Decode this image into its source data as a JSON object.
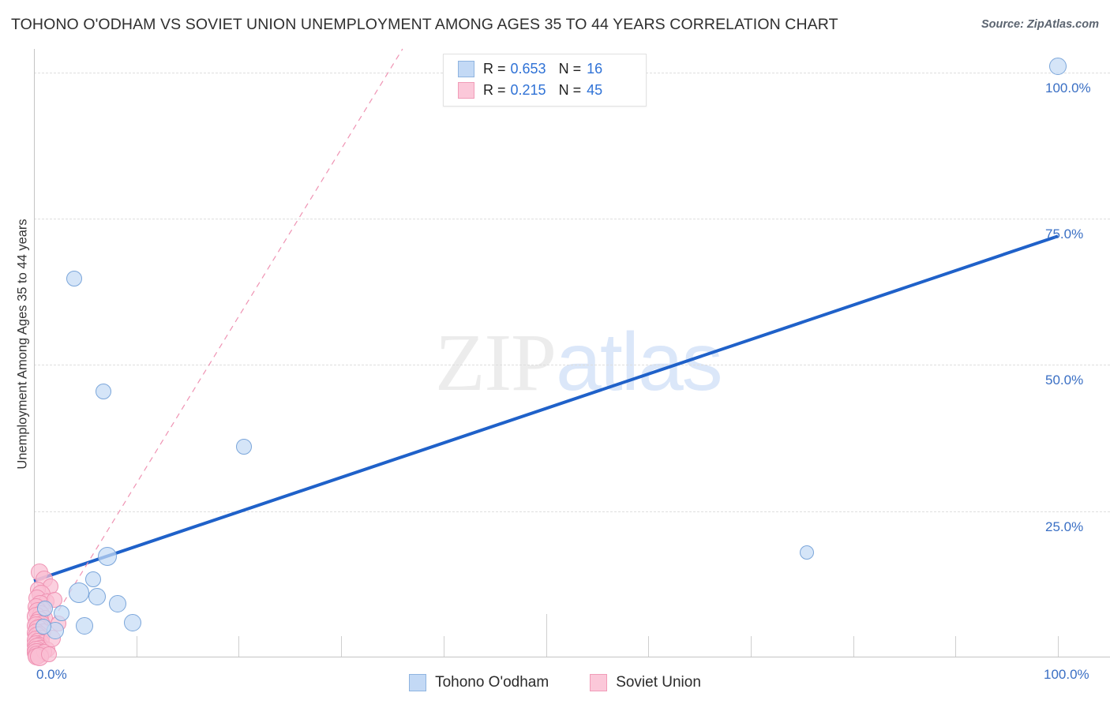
{
  "header": {
    "title": "TOHONO O'ODHAM VS SOVIET UNION UNEMPLOYMENT AMONG AGES 35 TO 44 YEARS CORRELATION CHART",
    "source": "Source: ZipAtlas.com"
  },
  "watermark": {
    "part1": "ZIP",
    "part2": "atlas"
  },
  "stats": {
    "rows": [
      {
        "series": "Tohono O'odham",
        "r_label": "R =",
        "r_value": "0.653",
        "n_label": "N =",
        "n_value": "16",
        "color": "#c3d9f5"
      },
      {
        "series": "Soviet Union",
        "r_label": "R =",
        "r_value": "0.215",
        "n_label": "N =",
        "n_value": "45",
        "color": "#fbc8d9"
      }
    ]
  },
  "legend": {
    "items": [
      {
        "label": "Tohono O'odham",
        "color": "#c3d9f5"
      },
      {
        "label": "Soviet Union",
        "color": "#fbc8d9"
      }
    ]
  },
  "axes": {
    "y_title": "Unemployment Among Ages 35 to 44 years",
    "y_ticks": [
      "100.0%",
      "75.0%",
      "50.0%",
      "25.0%"
    ],
    "x_ticks": [
      "0.0%",
      "100.0%"
    ],
    "tick_color": "#3a6fc4"
  },
  "chart_data": {
    "type": "scatter",
    "title": "Tohono O'odham vs Soviet Union Unemployment Among Ages 35 to 44 Years Correlation Chart",
    "xlabel": "",
    "ylabel": "Unemployment Among Ages 35 to 44 years",
    "xlim": [
      0,
      100
    ],
    "ylim": [
      0,
      104
    ],
    "x_tick_values": [
      0,
      100
    ],
    "y_tick_values": [
      25,
      50,
      75,
      100
    ],
    "grid": "horizontal-dashed",
    "legend_position": "bottom-center",
    "series": [
      {
        "name": "Tohono O'odham",
        "color": "#c3d9f5",
        "edge_color": "#7ba6da",
        "R": 0.653,
        "N": 16,
        "trendline": {
          "style": "solid",
          "color": "#1f61c9",
          "x0": 0,
          "y0": 13.1,
          "x1": 100,
          "y1": 72.0
        },
        "points": [
          {
            "x": 100.0,
            "y": 101.0,
            "r": 11
          },
          {
            "x": 3.9,
            "y": 64.8,
            "r": 10
          },
          {
            "x": 6.8,
            "y": 45.5,
            "r": 10
          },
          {
            "x": 20.5,
            "y": 36.0,
            "r": 10
          },
          {
            "x": 75.5,
            "y": 17.9,
            "r": 9
          },
          {
            "x": 7.2,
            "y": 17.2,
            "r": 12
          },
          {
            "x": 5.8,
            "y": 13.3,
            "r": 10
          },
          {
            "x": 4.4,
            "y": 11.1,
            "r": 13
          },
          {
            "x": 6.2,
            "y": 10.4,
            "r": 11
          },
          {
            "x": 8.2,
            "y": 9.2,
            "r": 11
          },
          {
            "x": 1.1,
            "y": 8.3,
            "r": 10
          },
          {
            "x": 2.7,
            "y": 7.6,
            "r": 10
          },
          {
            "x": 9.6,
            "y": 6.0,
            "r": 11
          },
          {
            "x": 4.9,
            "y": 5.4,
            "r": 11
          },
          {
            "x": 2.1,
            "y": 4.6,
            "r": 11
          },
          {
            "x": 0.9,
            "y": 5.2,
            "r": 10
          }
        ]
      },
      {
        "name": "Soviet Union",
        "color": "#fbc8d9",
        "edge_color": "#ef93b3",
        "R": 0.215,
        "N": 45,
        "trendline": {
          "style": "dashed",
          "color": "#ef93b3",
          "x0": 0.3,
          "y0": 2.0,
          "x1": 36.0,
          "y1": 104.0
        },
        "points": [
          {
            "x": 0.5,
            "y": 14.6,
            "r": 11
          },
          {
            "x": 1.0,
            "y": 13.3,
            "r": 11
          },
          {
            "x": 1.6,
            "y": 12.2,
            "r": 10
          },
          {
            "x": 0.4,
            "y": 11.6,
            "r": 10
          },
          {
            "x": 0.7,
            "y": 10.8,
            "r": 12
          },
          {
            "x": 0.3,
            "y": 10.1,
            "r": 11
          },
          {
            "x": 1.2,
            "y": 9.6,
            "r": 10
          },
          {
            "x": 0.6,
            "y": 9.0,
            "r": 12
          },
          {
            "x": 0.2,
            "y": 8.6,
            "r": 11
          },
          {
            "x": 0.9,
            "y": 8.2,
            "r": 10
          },
          {
            "x": 0.4,
            "y": 7.8,
            "r": 12
          },
          {
            "x": 0.7,
            "y": 7.4,
            "r": 11
          },
          {
            "x": 0.2,
            "y": 7.0,
            "r": 12
          },
          {
            "x": 1.1,
            "y": 6.7,
            "r": 10
          },
          {
            "x": 0.5,
            "y": 6.3,
            "r": 12
          },
          {
            "x": 0.3,
            "y": 6.0,
            "r": 11
          },
          {
            "x": 0.8,
            "y": 5.7,
            "r": 11
          },
          {
            "x": 0.2,
            "y": 5.4,
            "r": 12
          },
          {
            "x": 0.6,
            "y": 5.1,
            "r": 11
          },
          {
            "x": 0.4,
            "y": 4.8,
            "r": 12
          },
          {
            "x": 0.9,
            "y": 4.5,
            "r": 10
          },
          {
            "x": 0.2,
            "y": 4.2,
            "r": 12
          },
          {
            "x": 0.5,
            "y": 3.9,
            "r": 11
          },
          {
            "x": 0.3,
            "y": 3.6,
            "r": 12
          },
          {
            "x": 0.7,
            "y": 3.3,
            "r": 11
          },
          {
            "x": 0.2,
            "y": 3.0,
            "r": 12
          },
          {
            "x": 0.4,
            "y": 2.7,
            "r": 11
          },
          {
            "x": 0.8,
            "y": 2.5,
            "r": 10
          },
          {
            "x": 0.2,
            "y": 2.2,
            "r": 12
          },
          {
            "x": 0.5,
            "y": 2.0,
            "r": 11
          },
          {
            "x": 0.3,
            "y": 1.7,
            "r": 12
          },
          {
            "x": 0.6,
            "y": 1.5,
            "r": 11
          },
          {
            "x": 0.2,
            "y": 1.2,
            "r": 12
          },
          {
            "x": 0.4,
            "y": 1.0,
            "r": 11
          },
          {
            "x": 1.3,
            "y": 1.4,
            "r": 10
          },
          {
            "x": 0.2,
            "y": 0.8,
            "r": 12
          },
          {
            "x": 0.6,
            "y": 0.6,
            "r": 11
          },
          {
            "x": 0.3,
            "y": 0.4,
            "r": 12
          },
          {
            "x": 1.0,
            "y": 0.9,
            "r": 10
          },
          {
            "x": 0.2,
            "y": 0.2,
            "r": 11
          },
          {
            "x": 0.5,
            "y": 0.1,
            "r": 12
          },
          {
            "x": 2.0,
            "y": 9.8,
            "r": 10
          },
          {
            "x": 2.4,
            "y": 5.8,
            "r": 10
          },
          {
            "x": 1.8,
            "y": 3.2,
            "r": 11
          },
          {
            "x": 1.5,
            "y": 0.5,
            "r": 10
          }
        ]
      }
    ]
  }
}
